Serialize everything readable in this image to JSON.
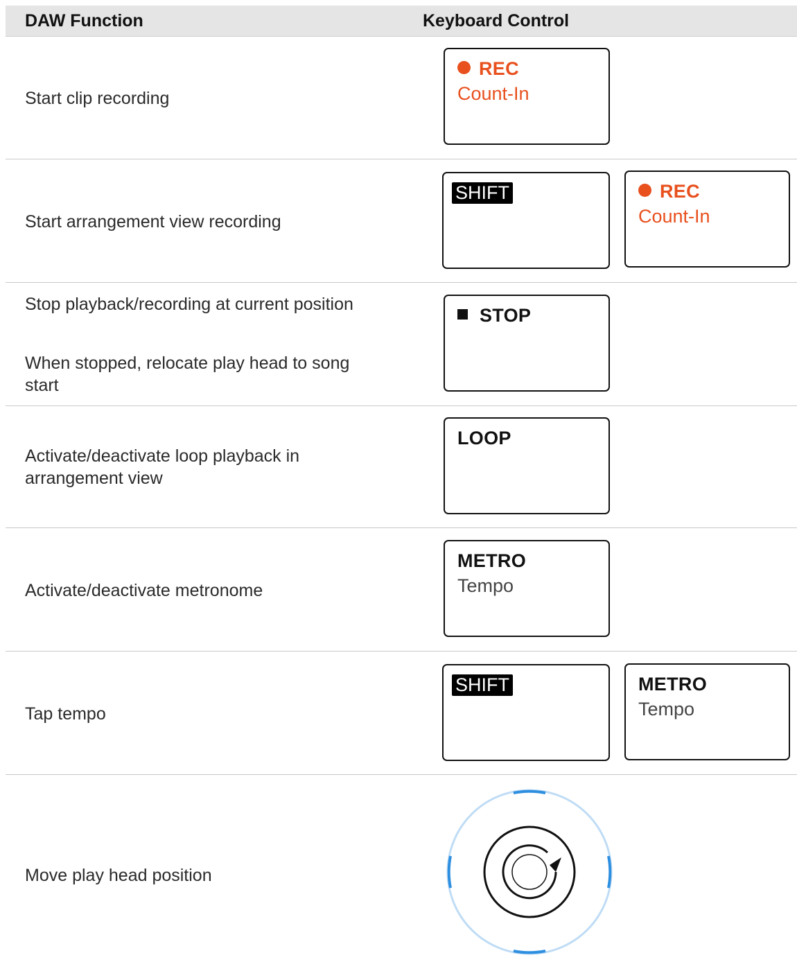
{
  "header": {
    "col1": "DAW Function",
    "col2": "Keyboard Control"
  },
  "rows": [
    {
      "function": "Start clip recording",
      "key": {
        "top": "REC",
        "bottom": "Count-In",
        "icon": "record-dot-icon"
      }
    },
    {
      "function": "Start arrangement view recording",
      "modifier": {
        "label": "SHIFT"
      },
      "key": {
        "top": "REC",
        "bottom": "Count-In",
        "icon": "record-dot-icon"
      }
    },
    {
      "function_line1": "Stop playback/recording at current position",
      "function_line2": "When stopped, relocate play head to song start",
      "key": {
        "top": "STOP",
        "icon": "stop-square-icon"
      }
    },
    {
      "function": "Activate/deactivate loop playback in arrangement view",
      "key": {
        "top": "LOOP"
      }
    },
    {
      "function": "Activate/deactivate metronome",
      "key": {
        "top": "METRO",
        "bottom": "Tempo"
      }
    },
    {
      "function": "Tap tempo",
      "modifier": {
        "label": "SHIFT"
      },
      "key": {
        "top": "METRO",
        "bottom": "Tempo"
      }
    },
    {
      "function": "Move play head position",
      "control": "4-d-encoder-rotate-icon"
    }
  ],
  "colors": {
    "record": "#e8501e",
    "header_bg": "#e5e5e5",
    "encoder_ring": "#bfdcf5",
    "encoder_marks": "#2e8fe0"
  }
}
